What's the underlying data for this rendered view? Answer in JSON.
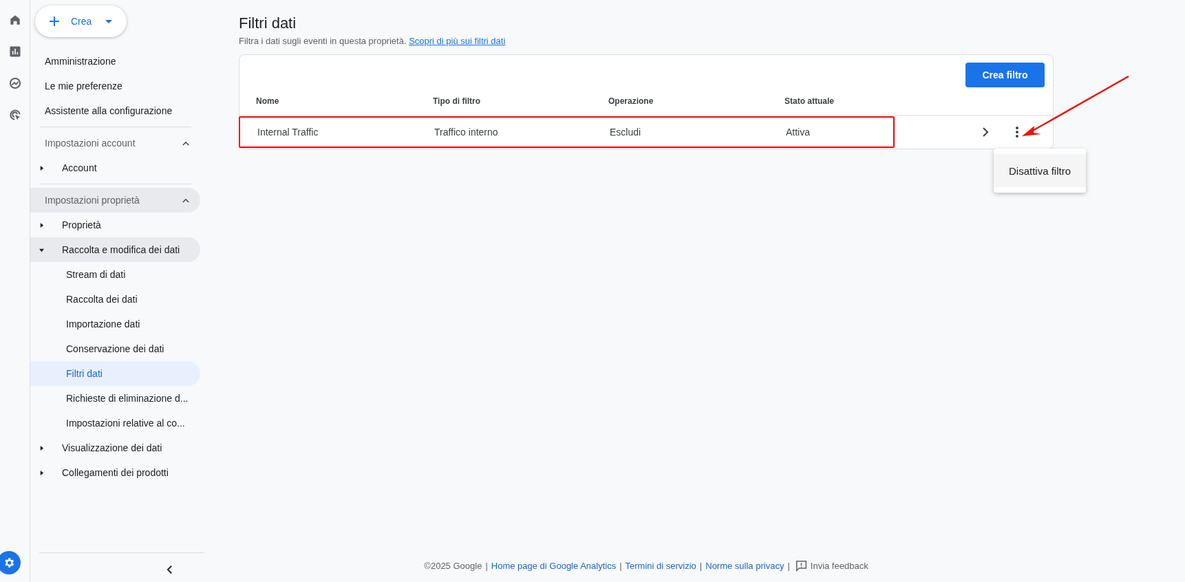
{
  "rail": [
    {
      "kind": "home",
      "selected": false
    },
    {
      "kind": "reports",
      "selected": false
    },
    {
      "kind": "explore",
      "selected": false
    },
    {
      "kind": "advertising",
      "selected": false
    }
  ],
  "rail_bottom": {
    "kind": "admin",
    "selected": true
  },
  "create_button": {
    "label": "Crea"
  },
  "sidebar": {
    "top_items": [
      "Amministrazione",
      "Le mie preferenze",
      "Assistente alla configurazione"
    ],
    "sections": [
      {
        "title": "Impostazioni account",
        "expanded": true,
        "highlighted": false,
        "items": [
          {
            "label": "Account",
            "expanded": false,
            "highlighted": false
          }
        ]
      },
      {
        "title": "Impostazioni proprietà",
        "expanded": true,
        "highlighted": true,
        "items": [
          {
            "label": "Proprietà",
            "expanded": false,
            "highlighted": false
          },
          {
            "label": "Raccolta e modifica dei dati",
            "expanded": true,
            "highlighted": true,
            "children": [
              {
                "label": "Stream di dati",
                "selected": false
              },
              {
                "label": "Raccolta dei dati",
                "selected": false
              },
              {
                "label": "Importazione dati",
                "selected": false
              },
              {
                "label": "Conservazione dei dati",
                "selected": false
              },
              {
                "label": "Filtri dati",
                "selected": true
              },
              {
                "label": "Richieste di eliminazione d...",
                "selected": false
              },
              {
                "label": "Impostazioni relative al co...",
                "selected": false
              }
            ]
          },
          {
            "label": "Visualizzazione dei dati",
            "expanded": false,
            "highlighted": false
          },
          {
            "label": "Collegamenti dei prodotti",
            "expanded": false,
            "highlighted": false
          }
        ]
      }
    ]
  },
  "page": {
    "title": "Filtri dati",
    "subtitle": "Filtra i dati sugli eventi in questa proprietà.",
    "help_link": "Scopri di più sui filtri dati"
  },
  "table": {
    "action_button": "Crea filtro",
    "columns": [
      "Nome",
      "Tipo di filtro",
      "Operazione",
      "Stato attuale"
    ],
    "rows": [
      {
        "cells": [
          "Internal Traffic",
          "Traffico interno",
          "Escludi",
          "Attiva"
        ],
        "annotated": true,
        "menu_open": true
      }
    ],
    "row_menu": [
      "Disattiva filtro"
    ]
  },
  "annotation_arrow": true,
  "footer": {
    "copyright": "©2025 Google",
    "links": [
      "Home page di Google Analytics",
      "Termini di servizio",
      "Norme sulla privacy"
    ],
    "separators": [
      "|",
      "|",
      "|",
      "|"
    ],
    "feedback": "Invia feedback"
  }
}
